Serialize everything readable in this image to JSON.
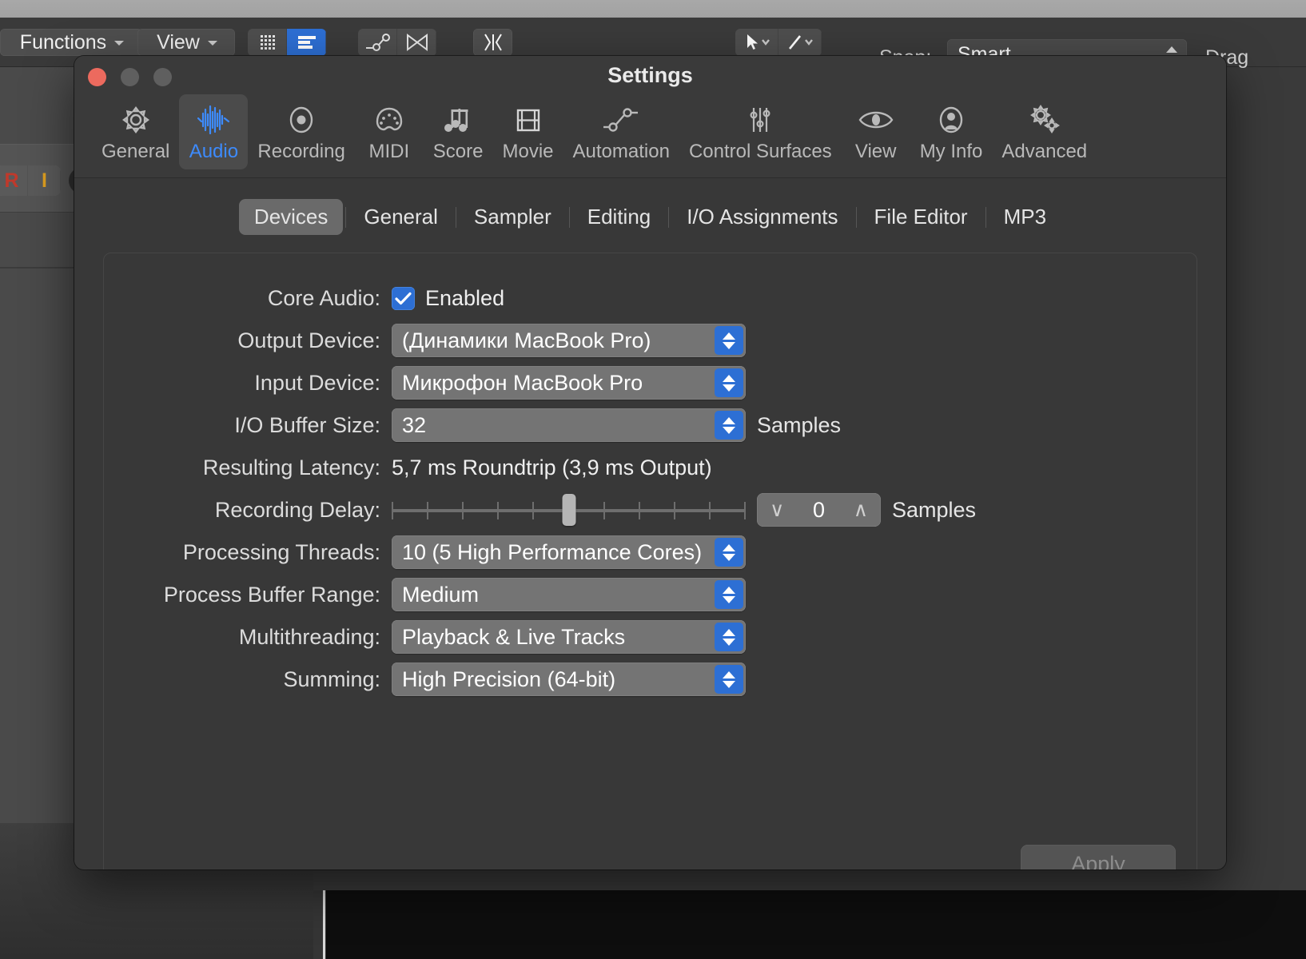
{
  "background": {
    "toolbar": {
      "functions_label": "Functions",
      "view_label": "View",
      "snap_label": "Snap:",
      "snap_value": "Smart",
      "drag_label": "Drag",
      "icons": {
        "grid": "grid-icon",
        "list": "list-icon",
        "automation": "automation-curve-icon",
        "flex": "flex-icon",
        "fade": "fade-icon"
      }
    },
    "track": {
      "record_label": "R",
      "input_label": "I"
    }
  },
  "dialog": {
    "title": "Settings",
    "window_controls": {
      "close": "close-button",
      "minimize": "minimize-button",
      "maximize": "maximize-button"
    },
    "toolbar_tabs": [
      {
        "label": "General",
        "icon": "gear-icon",
        "selected": false
      },
      {
        "label": "Audio",
        "icon": "waveform-icon",
        "selected": true
      },
      {
        "label": "Recording",
        "icon": "record-circle-icon",
        "selected": false
      },
      {
        "label": "MIDI",
        "icon": "midi-plug-icon",
        "selected": false
      },
      {
        "label": "Score",
        "icon": "music-notes-icon",
        "selected": false
      },
      {
        "label": "Movie",
        "icon": "film-strip-icon",
        "selected": false
      },
      {
        "label": "Automation",
        "icon": "automation-node-icon",
        "selected": false
      },
      {
        "label": "Control Surfaces",
        "icon": "sliders-icon",
        "selected": false
      },
      {
        "label": "View",
        "icon": "eye-icon",
        "selected": false
      },
      {
        "label": "My Info",
        "icon": "person-icon",
        "selected": false
      },
      {
        "label": "Advanced",
        "icon": "double-gear-icon",
        "selected": false
      }
    ],
    "subtabs": [
      {
        "label": "Devices",
        "active": true
      },
      {
        "label": "General",
        "active": false
      },
      {
        "label": "Sampler",
        "active": false
      },
      {
        "label": "Editing",
        "active": false
      },
      {
        "label": "I/O Assignments",
        "active": false
      },
      {
        "label": "File Editor",
        "active": false
      },
      {
        "label": "MP3",
        "active": false
      }
    ],
    "fields": {
      "core_audio": {
        "label": "Core Audio:",
        "checkbox_checked": true,
        "checkbox_label": "Enabled"
      },
      "output_device": {
        "label": "Output Device:",
        "value": "(Динамики MacBook Pro)"
      },
      "input_device": {
        "label": "Input Device:",
        "value": "Микрофон MacBook Pro"
      },
      "io_buffer_size": {
        "label": "I/O Buffer Size:",
        "value": "32",
        "unit": "Samples"
      },
      "resulting_latency": {
        "label": "Resulting Latency:",
        "value": "5,7 ms Roundtrip (3,9 ms Output)"
      },
      "recording_delay": {
        "label": "Recording Delay:",
        "slider_value": 0,
        "slider_min": -5000,
        "slider_max": 5000,
        "stepper_value": "0",
        "unit": "Samples",
        "decrement_glyph": "∨",
        "increment_glyph": "∧"
      },
      "processing_threads": {
        "label": "Processing Threads:",
        "value": "10    (5 High Performance Cores)"
      },
      "process_buffer_range": {
        "label": "Process Buffer Range:",
        "value": "Medium"
      },
      "multithreading": {
        "label": "Multithreading:",
        "value": "Playback & Live Tracks"
      },
      "summing": {
        "label": "Summing:",
        "value": "High Precision (64-bit)"
      }
    },
    "apply_button": {
      "label": "Apply",
      "enabled": false
    }
  },
  "colors": {
    "accent_blue": "#2d6fd4",
    "selected_tab_text": "#3d8bfd",
    "dialog_bg": "#383838",
    "popup_bg": "#747474",
    "close_red": "#ec6a5e"
  }
}
